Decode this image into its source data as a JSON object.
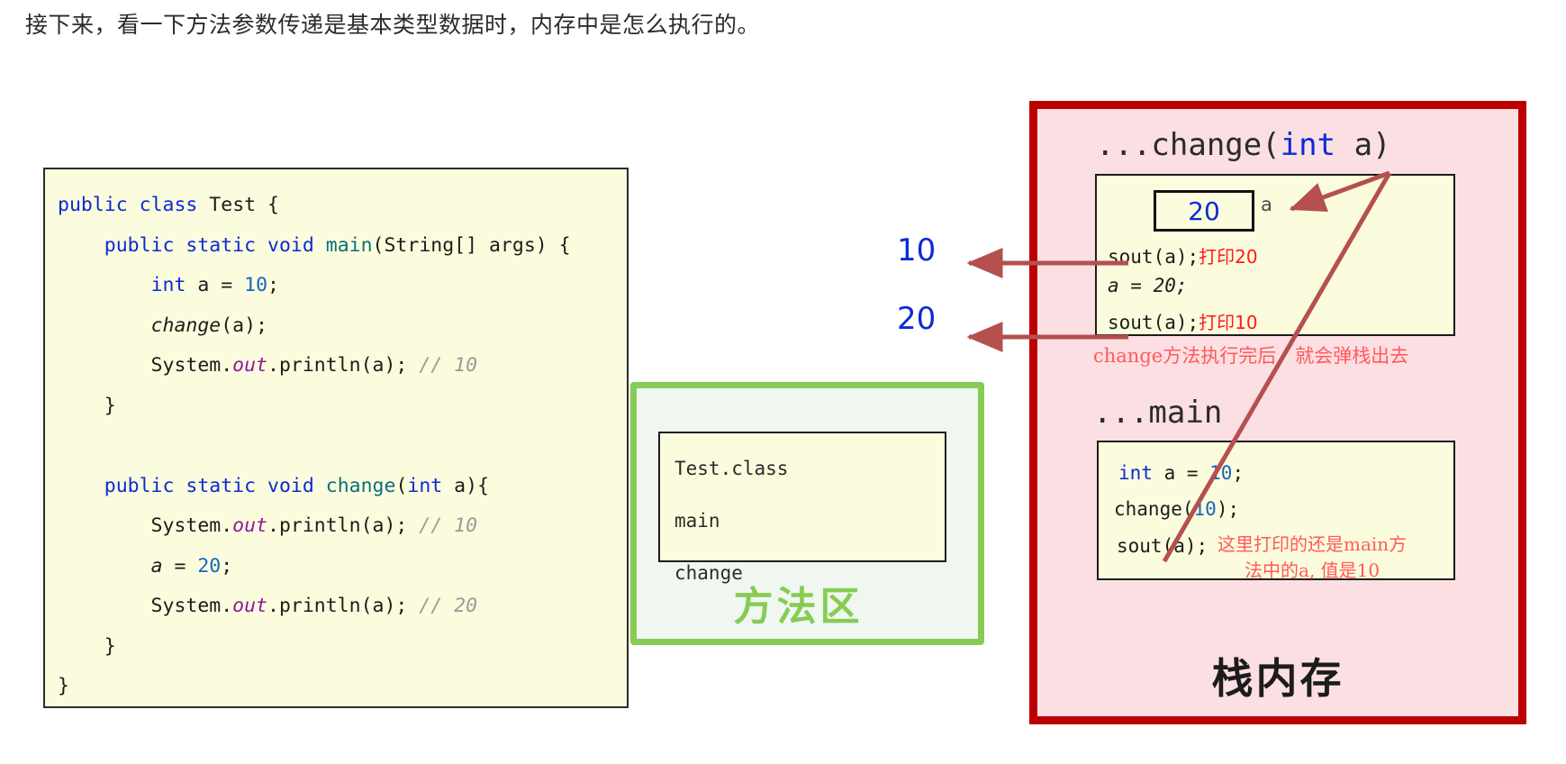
{
  "title": "接下来，看一下方法参数传递是基本类型数据时，内存中是怎么执行的。",
  "colors": {
    "code_bg": "#fbfbdd",
    "method_area_green": "#86cc54",
    "stack_border_red": "#bb0000",
    "stack_bg": "#fcdfe3",
    "keyword_blue": "#0d29d6",
    "annotation_red": "#ff1a1a",
    "comment_gray": "#9a9a9a"
  },
  "code_panel": {
    "lines": [
      "public class Test {",
      "    public static void main(String[] args) {",
      "        int a = 10;",
      "        change(a);",
      "        System.out.println(a); // 10",
      "    }",
      "",
      "    public static void change(int a){",
      "        System.out.println(a); // 10",
      "        a = 20;",
      "        System.out.println(a); // 20",
      "    }",
      "}"
    ]
  },
  "method_area": {
    "label": "方法区",
    "entries": [
      "Test.class",
      "main",
      "change"
    ]
  },
  "stack_memory": {
    "label": "栈内存",
    "change_frame": {
      "header": "...change(int a)",
      "var_value": "20",
      "var_name": "a",
      "lines": [
        {
          "code": "sout(a);",
          "note": "打印20"
        },
        {
          "code": "a = 20;",
          "note": ""
        },
        {
          "code": "sout(a);",
          "note": "打印10"
        }
      ],
      "pop_note": "change方法执行完后，就会弹栈出去"
    },
    "main_frame": {
      "header": "...main",
      "lines": [
        {
          "code": "int a = 10;"
        },
        {
          "code": "change(10);"
        },
        {
          "code": "sout(a);"
        }
      ],
      "note_line1": "这里打印的还是main方",
      "note_line2": "法中的a, 值是10"
    }
  },
  "output_values": {
    "first": "10",
    "second": "20"
  }
}
